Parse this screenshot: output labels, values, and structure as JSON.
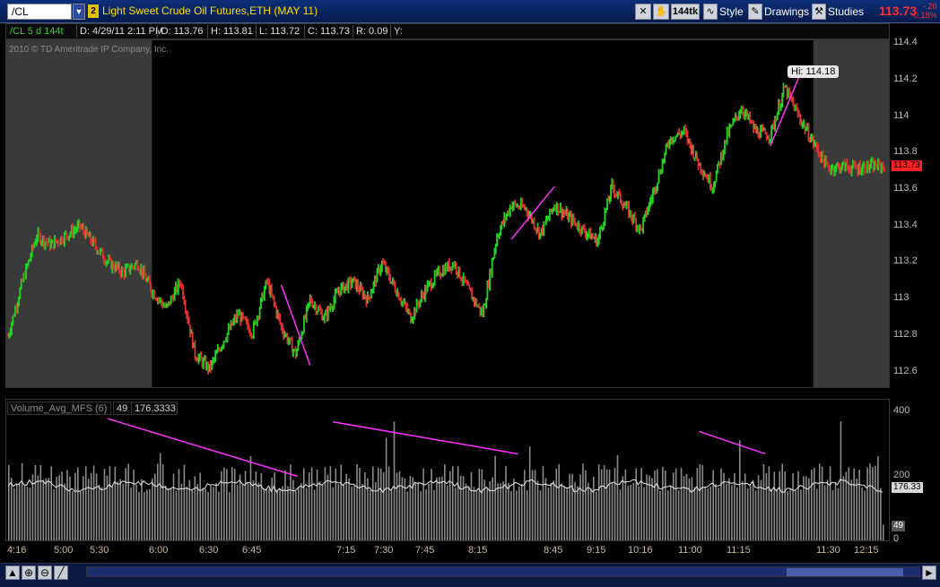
{
  "toolbar": {
    "symbol": "/CL",
    "link_group": "2",
    "description": "Light Sweet Crude Oil Futures,ETH (MAY 11)",
    "aggregation": "144tk",
    "style_label": "Style",
    "drawings_label": "Drawings",
    "studies_label": "Studies",
    "last_price": "113.73",
    "change": "-.20",
    "change_pct": "-0.18%"
  },
  "infobar": {
    "chart_label": "/CL 5 d 144t",
    "date": "D: 4/29/11 2:11 PM",
    "open": "O: 113.76",
    "high": "H: 113.81",
    "low": "L: 113.72",
    "close": "C: 113.73",
    "range": "R: 0.09",
    "y": "Y:"
  },
  "copyright": "2010 © TD Ameritrade IP Company, Inc.",
  "volume_header": {
    "study": "Volume_Avg_MFS (6)",
    "value1": "49",
    "value2": "176.3333"
  },
  "colors": {
    "up": "#22d422",
    "down": "#e03030",
    "trendline": "#ff30ff",
    "session_shade": "#3a3a3a",
    "volume_bar": "#8a8a8a",
    "volume_avg": "#e8e8e8",
    "price_tag": "#ff2020"
  },
  "chart_data": [
    {
      "type": "line",
      "title": "",
      "x_ticks": [
        "4:16",
        "5:00",
        "5:30",
        "6:00",
        "6:30",
        "6:45",
        "7:15",
        "7:30",
        "7:45",
        "8:15",
        "8:45",
        "9:15",
        "10:16",
        "11:00",
        "11:15",
        "11:30",
        "12:15"
      ],
      "y_ticks": [
        "114.4",
        "114.2",
        "114",
        "113.8",
        "113.6",
        "113.4",
        "113.2",
        "113",
        "112.8",
        "112.6"
      ],
      "ylim": [
        112.52,
        114.42
      ],
      "series": [
        {
          "values": [
            112.8,
            113.1,
            113.35,
            113.3,
            113.35,
            113.4,
            113.3,
            113.2,
            113.15,
            113.2,
            113.05,
            112.95,
            113.1,
            112.7,
            112.62,
            112.78,
            112.92,
            112.82,
            113.1,
            112.85,
            112.7,
            113.0,
            112.9,
            113.05,
            113.1,
            113.0,
            113.2,
            113.05,
            112.9,
            113.05,
            113.15,
            113.2,
            113.05,
            112.92,
            113.35,
            113.52,
            113.5,
            113.36,
            113.52,
            113.45,
            113.38,
            113.32,
            113.62,
            113.5,
            113.38,
            113.62,
            113.88,
            113.92,
            113.75,
            113.62,
            113.9,
            114.05,
            113.92,
            113.9,
            114.16,
            114.0,
            113.86,
            113.72,
            113.73,
            113.72,
            113.73,
            113.73
          ]
        }
      ],
      "session_shading": {
        "pre_end_index": 10,
        "post_start_index": 56
      },
      "trendlines_price": [
        {
          "from": [
            19,
            113.08
          ],
          "to": [
            21,
            112.64
          ]
        },
        {
          "from": [
            35,
            113.33
          ],
          "to": [
            38,
            113.62
          ]
        },
        {
          "from": [
            53,
            113.84
          ],
          "to": [
            55,
            114.22
          ]
        }
      ],
      "hi_label": "Hi: 114.18",
      "last_tag": "113.73"
    },
    {
      "type": "bar",
      "title": "",
      "y_ticks": [
        "400",
        "200",
        "0"
      ],
      "ylim": [
        0,
        400
      ],
      "series": [
        {
          "values": [
            176.33
          ]
        }
      ],
      "last_avg_tag": "176.33",
      "last_vol_tag": "49",
      "trendlines_volume": [
        {
          "from": [
            0.115,
            380
          ],
          "to": [
            0.33,
            200
          ]
        },
        {
          "from": [
            0.37,
            370
          ],
          "to": [
            0.58,
            270
          ]
        },
        {
          "from": [
            0.785,
            340
          ],
          "to": [
            0.86,
            270
          ]
        }
      ]
    }
  ]
}
